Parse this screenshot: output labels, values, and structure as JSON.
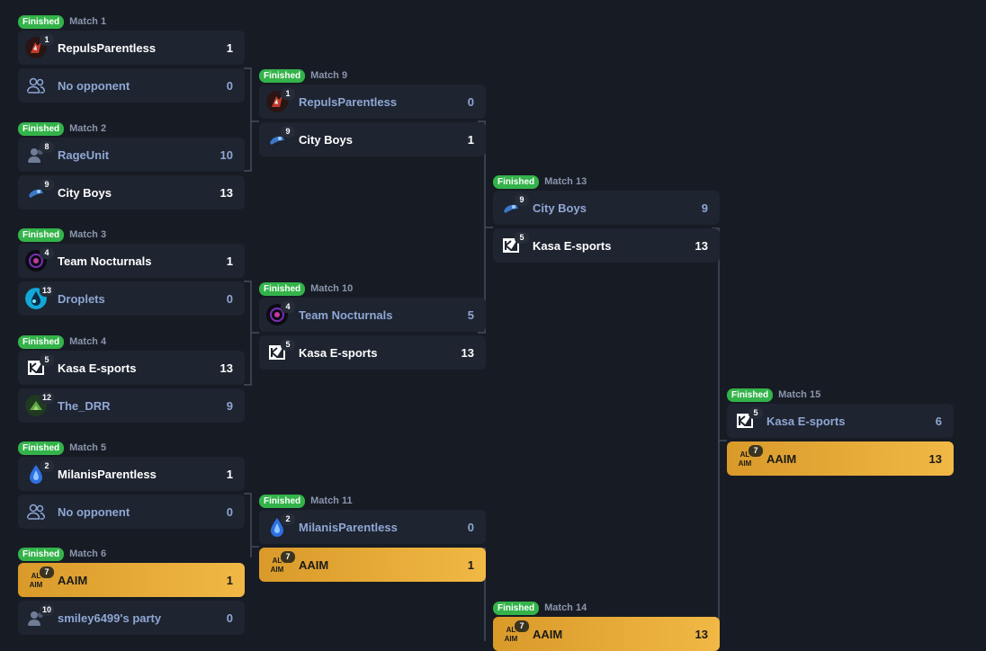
{
  "status_label": "Finished",
  "matches": [
    {
      "label": "Match 1",
      "teams": [
        {
          "name": "RepulsParentless",
          "seed": "1",
          "score": "1",
          "logo": "repuls-logo",
          "state": "win"
        },
        {
          "name": "No opponent",
          "seed": "",
          "score": "0",
          "logo": "users-icon",
          "state": "none"
        }
      ]
    },
    {
      "label": "Match 2",
      "teams": [
        {
          "name": "RageUnit",
          "seed": "8",
          "score": "10",
          "logo": "user-icon",
          "state": "lose"
        },
        {
          "name": "City Boys",
          "seed": "9",
          "score": "13",
          "logo": "cityboys-logo",
          "state": "win"
        }
      ]
    },
    {
      "label": "Match 3",
      "teams": [
        {
          "name": "Team Nocturnals",
          "seed": "4",
          "score": "1",
          "logo": "nocturnals-logo",
          "state": "win"
        },
        {
          "name": "Droplets",
          "seed": "13",
          "score": "0",
          "logo": "droplets-logo",
          "state": "lose"
        }
      ]
    },
    {
      "label": "Match 4",
      "teams": [
        {
          "name": "Kasa E-sports",
          "seed": "5",
          "score": "13",
          "logo": "kasa-logo",
          "state": "win"
        },
        {
          "name": "The_DRR",
          "seed": "12",
          "score": "9",
          "logo": "drr-logo",
          "state": "lose"
        }
      ]
    },
    {
      "label": "Match 5",
      "teams": [
        {
          "name": "MilanisParentless",
          "seed": "2",
          "score": "1",
          "logo": "milanis-logo",
          "state": "win"
        },
        {
          "name": "No opponent",
          "seed": "",
          "score": "0",
          "logo": "users-icon",
          "state": "none"
        }
      ]
    },
    {
      "label": "Match 6",
      "teams": [
        {
          "name": "AAIM",
          "seed": "7",
          "score": "1",
          "logo": "aaim-logo",
          "state": "gold"
        },
        {
          "name": "smiley6499's party",
          "seed": "10",
          "score": "0",
          "logo": "user-icon",
          "state": "lose"
        }
      ]
    },
    {
      "label": "Match 9",
      "teams": [
        {
          "name": "RepulsParentless",
          "seed": "1",
          "score": "0",
          "logo": "repuls-logo",
          "state": "lose"
        },
        {
          "name": "City Boys",
          "seed": "9",
          "score": "1",
          "logo": "cityboys-logo",
          "state": "win"
        }
      ]
    },
    {
      "label": "Match 10",
      "teams": [
        {
          "name": "Team Nocturnals",
          "seed": "4",
          "score": "5",
          "logo": "nocturnals-logo",
          "state": "lose"
        },
        {
          "name": "Kasa E-sports",
          "seed": "5",
          "score": "13",
          "logo": "kasa-logo",
          "state": "win"
        }
      ]
    },
    {
      "label": "Match 11",
      "teams": [
        {
          "name": "MilanisParentless",
          "seed": "2",
          "score": "0",
          "logo": "milanis-logo",
          "state": "lose"
        },
        {
          "name": "AAIM",
          "seed": "7",
          "score": "1",
          "logo": "aaim-logo",
          "state": "gold"
        }
      ]
    },
    {
      "label": "Match 13",
      "teams": [
        {
          "name": "City Boys",
          "seed": "9",
          "score": "9",
          "logo": "cityboys-logo",
          "state": "lose"
        },
        {
          "name": "Kasa E-sports",
          "seed": "5",
          "score": "13",
          "logo": "kasa-logo",
          "state": "win"
        }
      ]
    },
    {
      "label": "Match 14",
      "teams": [
        {
          "name": "AAIM",
          "seed": "7",
          "score": "13",
          "logo": "aaim-logo",
          "state": "gold"
        }
      ]
    },
    {
      "label": "Match 15",
      "teams": [
        {
          "name": "Kasa E-sports",
          "seed": "5",
          "score": "6",
          "logo": "kasa-logo",
          "state": "lose"
        },
        {
          "name": "AAIM",
          "seed": "7",
          "score": "13",
          "logo": "aaim-logo",
          "state": "gold"
        }
      ]
    }
  ],
  "colors": {
    "finished": "#33b34a",
    "winner_gold": "#f1b845",
    "loser_text": "#8fa7d4",
    "background": "#171b24",
    "slot": "#1e2430"
  }
}
